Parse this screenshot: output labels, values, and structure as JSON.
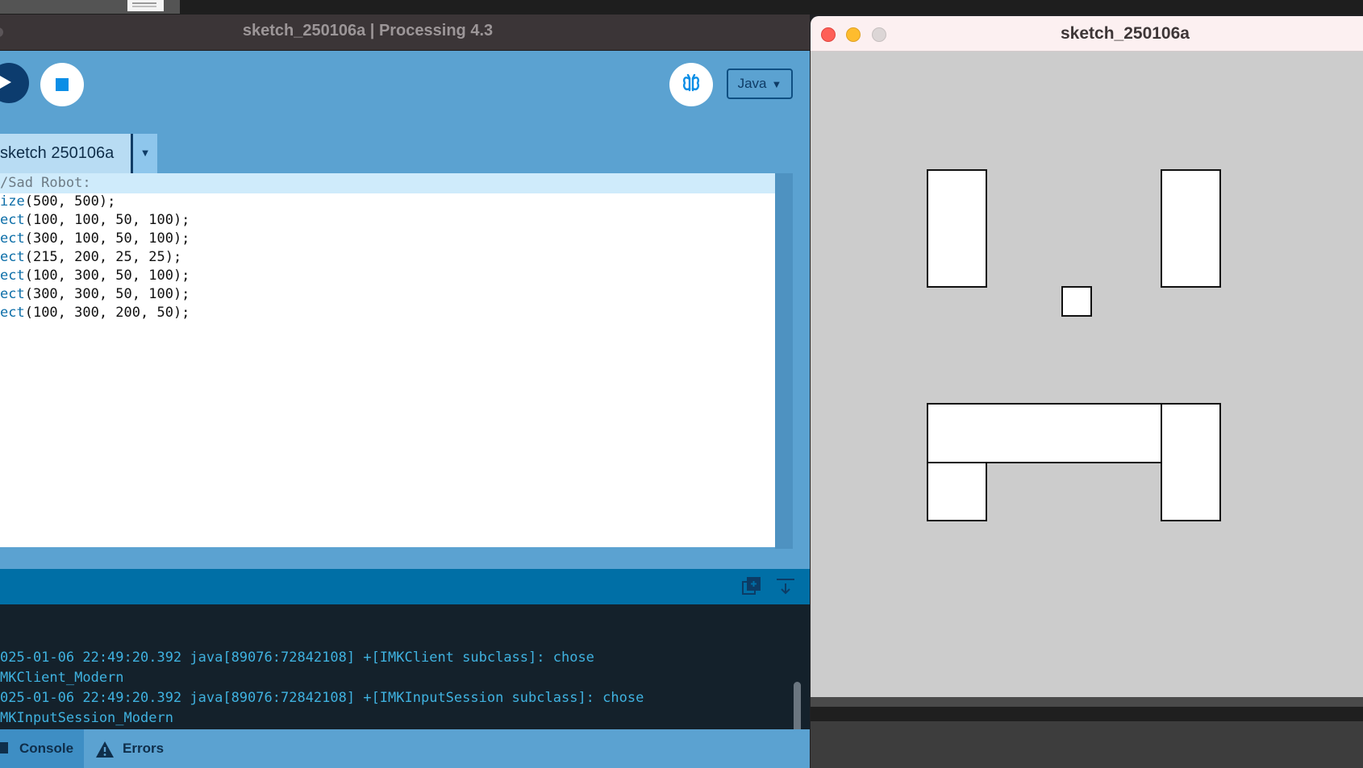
{
  "ide": {
    "title": "sketch_250106a | Processing 4.3",
    "mode_label": "Java",
    "tab_label": "sketch 250106a",
    "code_lines": [
      {
        "pre": "/Sad Robot:",
        "fn": "",
        "args": ""
      },
      {
        "pre": "",
        "fn": "ize",
        "args": "(500, 500);"
      },
      {
        "pre": "",
        "fn": "ect",
        "args": "(100, 100, 50, 100);"
      },
      {
        "pre": "",
        "fn": "ect",
        "args": "(300, 100, 50, 100);"
      },
      {
        "pre": "",
        "fn": "ect",
        "args": "(215, 200, 25, 25);"
      },
      {
        "pre": "",
        "fn": "ect",
        "args": "(100, 300, 50, 100);"
      },
      {
        "pre": "",
        "fn": "ect",
        "args": "(300, 300, 50, 100);"
      },
      {
        "pre": "",
        "fn": "ect",
        "args": "(100, 300, 200, 50);"
      }
    ],
    "console_lines": [
      "025-01-06 22:49:20.392 java[89076:72842108] +[IMKClient subclass]: chose",
      "MKClient_Modern",
      "025-01-06 22:49:20.392 java[89076:72842108] +[IMKInputSession subclass]: chose",
      "MKInputSession_Modern"
    ],
    "console_tab_label": "Console",
    "errors_tab_label": "Errors"
  },
  "sketch_window": {
    "title": "sketch_250106a",
    "canvas_size": [
      500,
      500
    ],
    "background": "#cccccc",
    "rects": [
      [
        100,
        100,
        50,
        100
      ],
      [
        300,
        100,
        50,
        100
      ],
      [
        215,
        200,
        25,
        25
      ],
      [
        100,
        300,
        50,
        100
      ],
      [
        300,
        300,
        50,
        100
      ],
      [
        100,
        300,
        200,
        50
      ]
    ]
  },
  "colors": {
    "ide_blue": "#5ba2d1",
    "console_bg": "#14212b",
    "console_text": "#3fb2e0",
    "keyword": "#0c6ea8"
  }
}
